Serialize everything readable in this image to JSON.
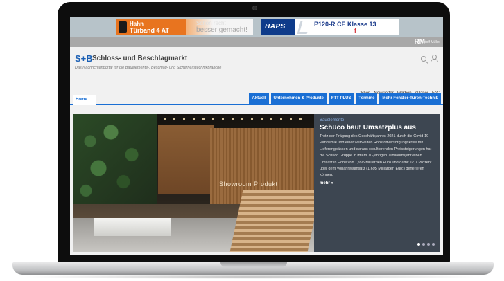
{
  "ad": {
    "hahn_line1": "Hahn",
    "hahn_line2": "Türband 4 AT",
    "besser_line1": "Schon recht",
    "besser_line2": "besser gemacht!",
    "haps": "HAPS",
    "p120": "P120-R CE Klasse 13",
    "p120_mark": "f"
  },
  "topbar": {
    "rm": "RM",
    "rm_sub": "Rudolf Müller"
  },
  "header": {
    "brand": "S+B",
    "name": "Schloss- und Beschlagmarkt",
    "tagline": "Das Nachrichtenportal für die Bauelemente-, Beschlag- und Sicherheitstechnikbranche",
    "links": [
      "Shop",
      "Newsletter",
      "Werben",
      "ePaper",
      "FAQ"
    ]
  },
  "nav": {
    "home": "Home",
    "items": [
      "Aktuell",
      "Unternehmen & Produkte",
      "FTT PLUS",
      "Termine",
      "Mehr Fenster-Türen-Technik"
    ]
  },
  "hero": {
    "photo_text": "Showroom Produkt",
    "category": "Bauelemente",
    "title": "Schüco baut Umsatzplus aus",
    "body": "Trotz der Prägung des Geschäftsjahres 2021 durch die Covid-19-Pandemie und einer weltweiten Rohstoffversorgungskrise mit Lieferengpässen und daraus resultierenden Preissteigerungen hat die Schüco Gruppe in ihrem 70-jährigen Jubiläumsjahr einen Umsatz in Höhe von 1,995 Milliarden Euro und damit 17,7 Prozent über dem Vorjahresumsatz (1,695 Milliarden Euro) generieren können.",
    "more": "mehr »",
    "dots": 4,
    "active_dot": 0
  },
  "colors": {
    "accent": "#1a6fd4",
    "hero_panel": "#3d4651",
    "ad_orange": "#e8741f",
    "haps_blue": "#0e3b8a"
  }
}
